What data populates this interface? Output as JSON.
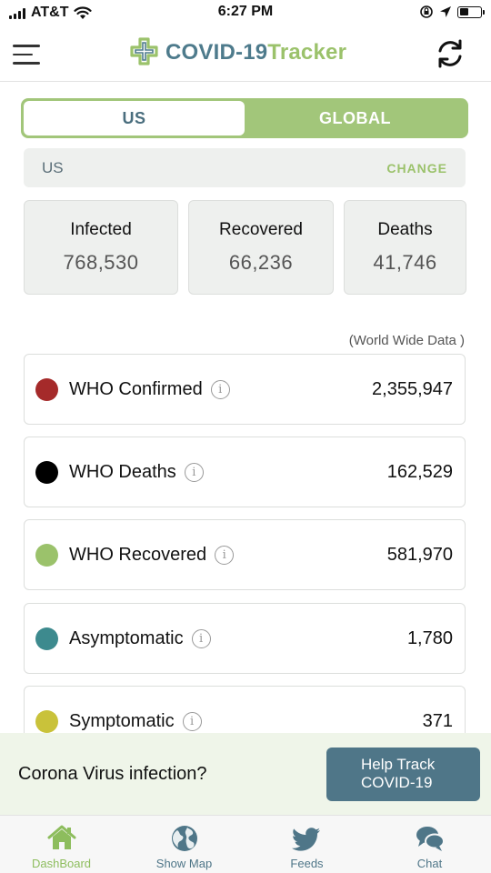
{
  "status_bar": {
    "carrier": "AT&T",
    "time": "6:27 PM"
  },
  "header": {
    "brand_part1": "COVID-19",
    "brand_part2": "Tracker"
  },
  "segment": {
    "options": [
      "US",
      "GLOBAL"
    ],
    "selected": "US"
  },
  "region": {
    "name": "US",
    "change_label": "CHANGE"
  },
  "stats": [
    {
      "label": "Infected",
      "value": "768,530"
    },
    {
      "label": "Recovered",
      "value": "66,236"
    },
    {
      "label": "Deaths",
      "value": "41,746"
    }
  ],
  "world_caption": "(World Wide Data )",
  "who_list": [
    {
      "label": "WHO Confirmed",
      "value": "2,355,947",
      "color": "#a52a2a"
    },
    {
      "label": "WHO Deaths",
      "value": "162,529",
      "color": "#000000"
    },
    {
      "label": "WHO Recovered",
      "value": "581,970",
      "color": "#9bc26b"
    },
    {
      "label": "Asymptomatic",
      "value": "1,780",
      "color": "#3d8a8e"
    },
    {
      "label": "Symptomatic",
      "value": "371",
      "color": "#c9c23a"
    }
  ],
  "help": {
    "question": "Corona Virus infection?",
    "button_line1": "Help Track",
    "button_line2": "COVID-19"
  },
  "tabs": [
    {
      "label": "DashBoard",
      "icon": "home-icon",
      "active": true
    },
    {
      "label": "Show Map",
      "icon": "globe-icon",
      "active": false
    },
    {
      "label": "Feeds",
      "icon": "twitter-bird-icon",
      "active": false
    },
    {
      "label": "Chat",
      "icon": "chat-bubbles-icon",
      "active": false
    }
  ],
  "colors": {
    "accent_green": "#9bc26b",
    "brand_blue": "#4f7688"
  }
}
